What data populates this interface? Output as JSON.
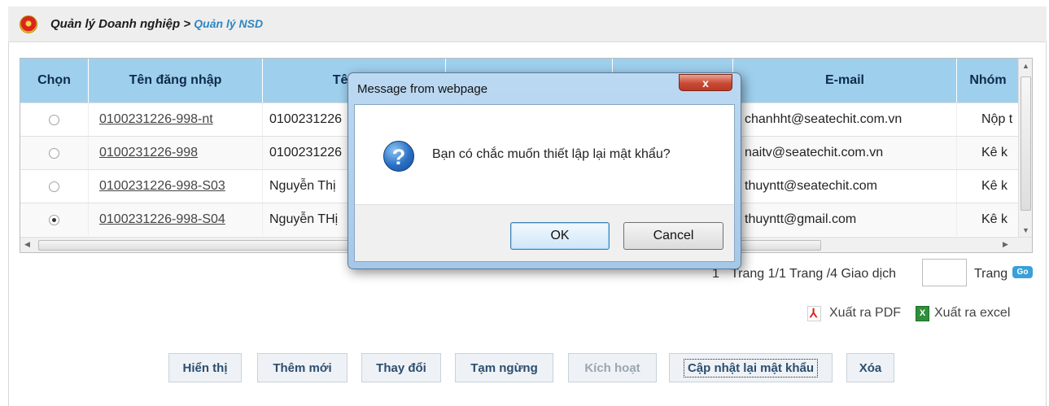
{
  "breadcrumb": {
    "parent": "Quản lý Doanh nghiệp",
    "separator": ">",
    "current": "Quản lý NSD"
  },
  "table": {
    "columns": [
      "Chọn",
      "Tên đăng nhập",
      "Tên ng",
      "",
      "",
      "E-mail",
      "Nhóm"
    ],
    "rows": [
      {
        "selected": false,
        "username": "0100231226-998-nt",
        "name": "0100231226",
        "email": "chanhht@seatechit.com.vn",
        "group": "Nộp t"
      },
      {
        "selected": false,
        "username": "0100231226-998",
        "name": "0100231226",
        "email": "naitv@seatechit.com.vn",
        "group": "Kê k"
      },
      {
        "selected": false,
        "username": "0100231226-998-S03",
        "name": "Nguyễn Thị",
        "email": "thuyntt@seatechit.com",
        "group": "Kê k"
      },
      {
        "selected": true,
        "username": "0100231226-998-S04",
        "name": "Nguyễn THị",
        "email": "thuyntt@gmail.com",
        "group": "Kê k"
      }
    ]
  },
  "pager": {
    "prefix": "1",
    "info": "Trang 1/1 Trang /4 Giao dịch",
    "page_input_value": "",
    "page_label": "Trang",
    "go_label": "Go"
  },
  "export": {
    "pdf_label": "Xuất ra PDF",
    "excel_label": "Xuất ra excel",
    "excel_icon_glyph": "X"
  },
  "actions": {
    "view": "Hiển thị",
    "add": "Thêm mới",
    "edit": "Thay đổi",
    "suspend": "Tạm ngừng",
    "activate": "Kích hoạt",
    "reset_password": "Cập nhật lại mật khẩu",
    "delete": "Xóa"
  },
  "dialog": {
    "title": "Message from webpage",
    "close_glyph": "x",
    "icon_glyph": "?",
    "message": "Bạn có chắc muốn thiết lập lại mật khẩu?",
    "ok_label": "OK",
    "cancel_label": "Cancel"
  },
  "colors": {
    "header_bg": "#9ed0ee",
    "link_blue": "#2e86c1",
    "close_red": "#c94a33"
  }
}
